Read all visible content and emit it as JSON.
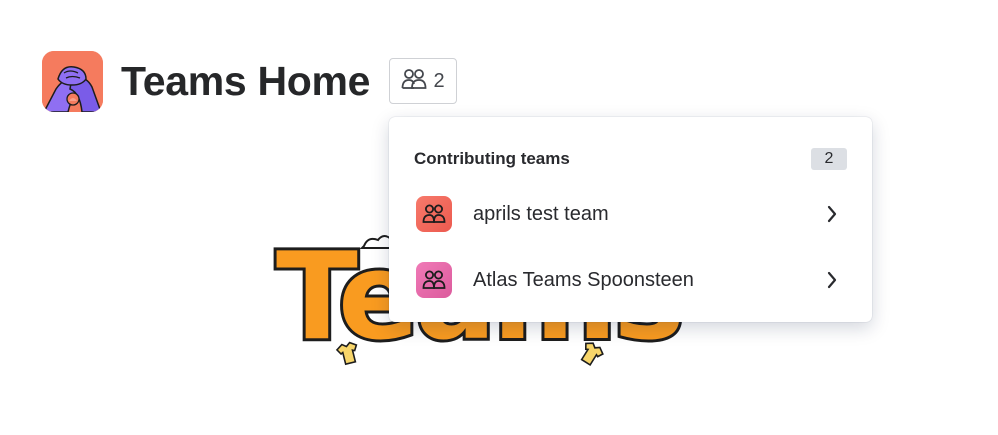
{
  "header": {
    "title": "Teams Home",
    "team_count": "2",
    "logo_icon": "hands-clasp-logo",
    "team_icon": "people-group-icon"
  },
  "hero": {
    "wordmark": "Teams",
    "colors": {
      "fill": "#f99b20",
      "outline": "#1d1d1d",
      "accent": "#f7d56a"
    }
  },
  "popup": {
    "title": "Contributing teams",
    "count": "2",
    "teams": [
      {
        "name": "aprils test team",
        "avatar_color": "#f0665b",
        "icon": "people-group-icon"
      },
      {
        "name": "Atlas Teams Spoonsteen",
        "avatar_color": "#e463a5",
        "icon": "people-group-icon"
      }
    ]
  },
  "colors": {
    "logo_bg": "#f57b5e",
    "logo_hands": "#8f6ff2",
    "text": "#292a2e",
    "badge_bg": "#dcdfe4"
  }
}
